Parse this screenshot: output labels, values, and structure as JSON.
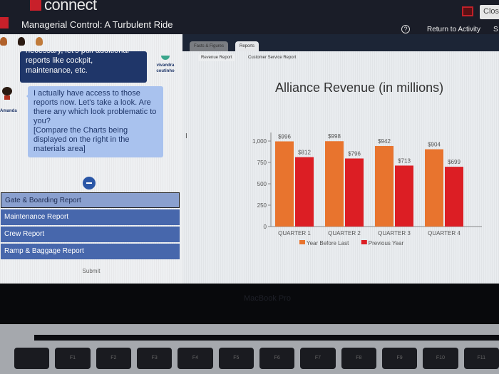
{
  "app": {
    "brand": "connect",
    "title": "Managerial Control: A Turbulent Ride",
    "close_label": "Clos",
    "return_label": "Return to Activity",
    "s_label": "S",
    "help_icon": "?"
  },
  "chat": {
    "message_dark": "necessary, let's pull additional reports like cockpit, maintenance, etc.",
    "vivandra_name": "vivandra coutinho",
    "amanda_name": "Amanda",
    "message_light": "I actually have access to those reports now. Let's take a look. Are there any which look problematic to you?\n[Compare the Charts being displayed on the right in the materials area]"
  },
  "reports": {
    "items": [
      {
        "label": "Gate & Boarding Report",
        "selected": true
      },
      {
        "label": "Maintenance Report",
        "selected": false
      },
      {
        "label": "Crew Report",
        "selected": false
      },
      {
        "label": "Ramp & Baggage Report",
        "selected": false
      }
    ],
    "submit_label": "Submit"
  },
  "materials": {
    "tabs": [
      "Facts & Figures",
      "Reports"
    ],
    "active_tab": "Reports",
    "subtabs": [
      "Revenue Report",
      "Customer Service Report"
    ],
    "active_subtab": "Revenue Report"
  },
  "chart_data": {
    "type": "bar",
    "title": "Alliance Revenue (in millions)",
    "categories": [
      "QUARTER 1",
      "QUARTER 2",
      "QUARTER 3",
      "QUARTER 4"
    ],
    "series": [
      {
        "name": "Year Before Last",
        "values": [
          996,
          998,
          942,
          904
        ],
        "labels": [
          "$996",
          "$998",
          "$942",
          "$904"
        ],
        "color": "#e8742e"
      },
      {
        "name": "Previous Year",
        "values": [
          812,
          796,
          713,
          699
        ],
        "labels": [
          "$812",
          "$796",
          "$713",
          "$699"
        ],
        "color": "#dc1e24"
      }
    ],
    "yticks": [
      0,
      250,
      500,
      750,
      1000
    ],
    "ytick_labels": [
      "0",
      "250",
      "500",
      "750",
      "1,000"
    ],
    "ylim": [
      0,
      1100
    ],
    "xlabel": "",
    "ylabel": "",
    "legend": "bottom",
    "grid": false
  },
  "device": {
    "bezel_text": "MacBook Pro",
    "keys": [
      "",
      "F1",
      "F2",
      "F3",
      "F4",
      "F5",
      "F6",
      "F7",
      "F8",
      "F9",
      "F10",
      "F11"
    ]
  }
}
